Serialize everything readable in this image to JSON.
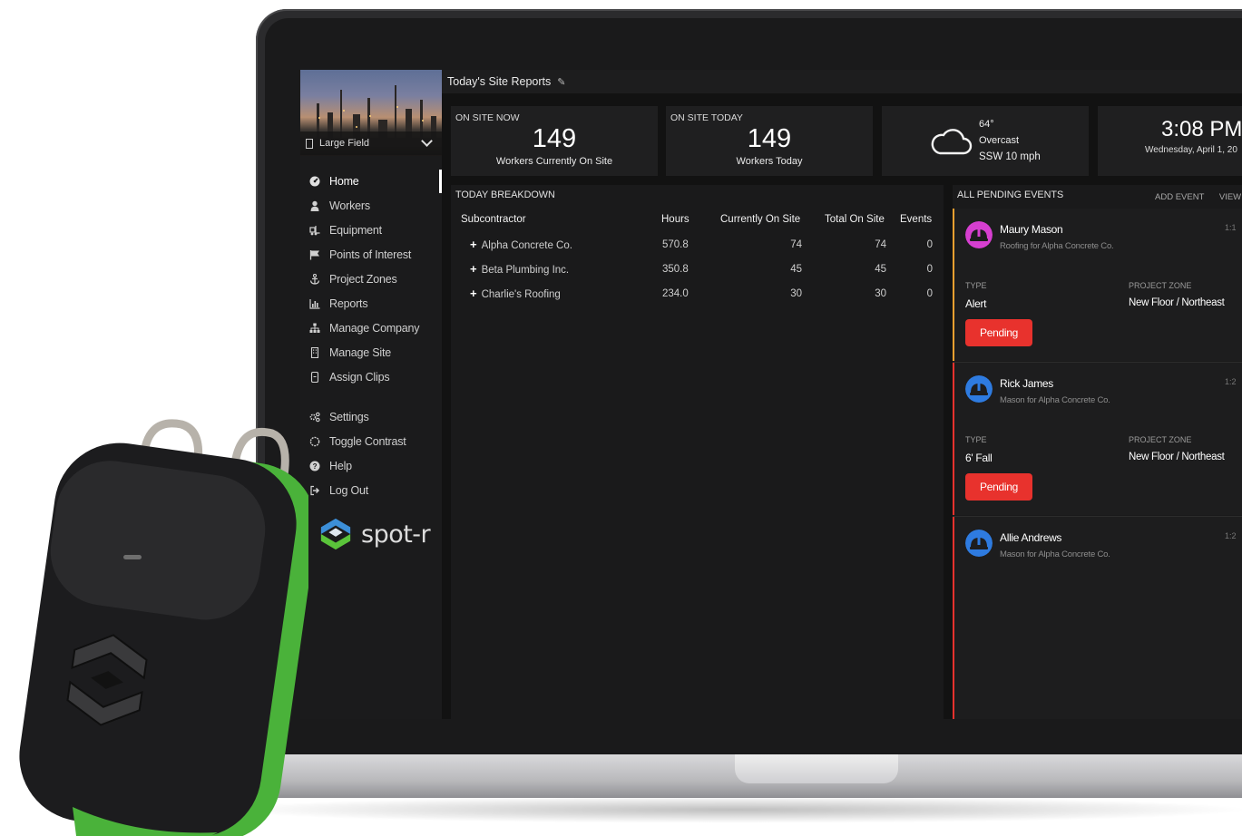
{
  "header": {
    "title": "Today's Site Reports"
  },
  "site": {
    "name": "Large Field"
  },
  "sidebar": {
    "items": [
      {
        "label": "Home",
        "icon": "dashboard-icon"
      },
      {
        "label": "Workers",
        "icon": "user-icon"
      },
      {
        "label": "Equipment",
        "icon": "forklift-icon"
      },
      {
        "label": "Points of Interest",
        "icon": "flag-icon"
      },
      {
        "label": "Project Zones",
        "icon": "anchor-icon"
      },
      {
        "label": "Reports",
        "icon": "bar-chart-icon"
      },
      {
        "label": "Manage Company",
        "icon": "org-chart-icon"
      },
      {
        "label": "Manage Site",
        "icon": "building-icon"
      },
      {
        "label": "Assign Clips",
        "icon": "clip-icon"
      }
    ],
    "secondary": [
      {
        "label": "Settings",
        "icon": "gears-icon"
      },
      {
        "label": "Toggle Contrast",
        "icon": "contrast-icon"
      },
      {
        "label": "Help",
        "icon": "help-icon"
      },
      {
        "label": "Log Out",
        "icon": "logout-icon"
      }
    ],
    "logo_text": "spot-r"
  },
  "stats": {
    "on_site_now": {
      "label": "ON SITE NOW",
      "value": "149",
      "sub": "Workers Currently On Site"
    },
    "on_site_today": {
      "label": "ON SITE TODAY",
      "value": "149",
      "sub": "Workers Today"
    }
  },
  "weather": {
    "temp": "64°",
    "condition": "Overcast",
    "wind": "SSW 10 mph",
    "icon": "cloud-icon"
  },
  "clock": {
    "time": "3:08 PM",
    "date": "Wednesday, April 1, 20"
  },
  "breakdown": {
    "title": "TODAY BREAKDOWN",
    "columns": [
      "Subcontractor",
      "Hours",
      "Currently On Site",
      "Total On Site",
      "Events"
    ],
    "rows": [
      {
        "name": "Alpha Concrete Co.",
        "hours": "570.8",
        "current": "74",
        "total": "74",
        "events": "0"
      },
      {
        "name": "Beta Plumbing Inc.",
        "hours": "350.8",
        "current": "45",
        "total": "45",
        "events": "0"
      },
      {
        "name": "Charlie's Roofing",
        "hours": "234.0",
        "current": "30",
        "total": "30",
        "events": "0"
      }
    ]
  },
  "events": {
    "title": "ALL PENDING EVENTS",
    "add_label": "ADD EVENT",
    "view_label": "VIEW",
    "type_label": "TYPE",
    "zone_label": "PROJECT ZONE",
    "items": [
      {
        "name": "Maury Mason",
        "role": "Roofing for Alpha Concrete Co.",
        "time": "1:1",
        "type": "Alert",
        "zone": "New Floor / Northeast",
        "status": "Pending",
        "accent": "#f0a030",
        "avatar_color": "#d63fd0"
      },
      {
        "name": "Rick James",
        "role": "Mason for Alpha Concrete Co.",
        "time": "1:2",
        "type": "6' Fall",
        "zone": "New Floor / Northeast",
        "status": "Pending",
        "accent": "#e8322d",
        "avatar_color": "#2e7be0"
      },
      {
        "name": "Allie Andrews",
        "role": "Mason for Alpha Concrete Co.",
        "time": "1:2",
        "type": "",
        "zone": "",
        "status": "",
        "accent": "#e8322d",
        "avatar_color": "#2e7be0"
      }
    ]
  },
  "colors": {
    "pending_button": "#e8322d",
    "brand_green": "#5ac43a",
    "brand_blue": "#3c8fd8"
  }
}
